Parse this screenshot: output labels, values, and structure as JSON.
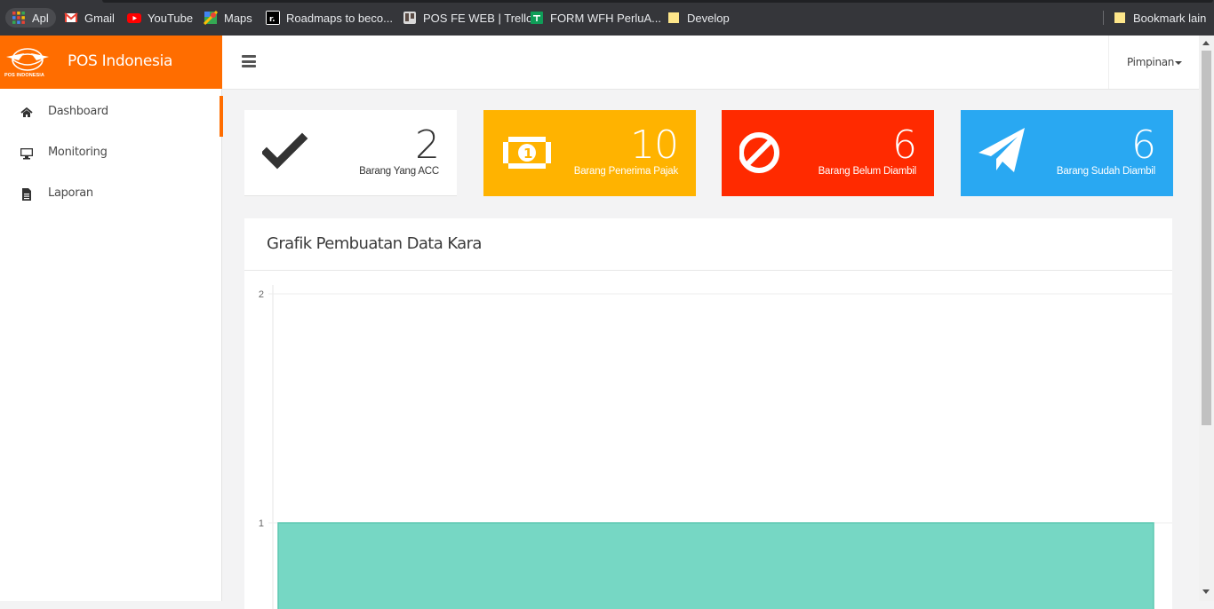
{
  "bookmarks": {
    "apps_label": "Apl",
    "items": [
      {
        "label": "Gmail",
        "icon": "gmail-icon"
      },
      {
        "label": "YouTube",
        "icon": "youtube-icon"
      },
      {
        "label": "Maps",
        "icon": "maps-icon"
      },
      {
        "label": "Roadmaps to beco...",
        "icon": "roadmap-icon"
      },
      {
        "label": "POS FE WEB | Trello",
        "icon": "trello-icon"
      },
      {
        "label": "FORM WFH PerluA...",
        "icon": "sheets-icon"
      },
      {
        "label": "Develop",
        "icon": "folder-icon"
      }
    ],
    "other_label": "Bookmark lain"
  },
  "brand": {
    "title": "POS Indonesia",
    "logo_text": "POS INDONESIA",
    "color": "#ff6d00"
  },
  "sidebar": {
    "items": [
      {
        "label": "Dashboard",
        "icon": "home-icon",
        "active": true
      },
      {
        "label": "Monitoring",
        "icon": "monitor-icon",
        "active": false
      },
      {
        "label": "Laporan",
        "icon": "document-icon",
        "active": false
      }
    ]
  },
  "topbar": {
    "user_label": "Pimpinan"
  },
  "cards": [
    {
      "value": "2",
      "label": "Barang Yang ACC",
      "icon": "check-icon",
      "color": "#ffffff"
    },
    {
      "value": "10",
      "label": "Barang Penerima Pajak",
      "icon": "money-icon",
      "color": "#ffb300"
    },
    {
      "value": "6",
      "label": "Barang Belum Diambil",
      "icon": "ban-icon",
      "color": "#ff2a00"
    },
    {
      "value": "6",
      "label": "Barang Sudah Diambil",
      "icon": "paper-plane-icon",
      "color": "#29a8f2"
    }
  ],
  "panel": {
    "title": "Grafik Pembuatan Data Kara"
  },
  "chart_data": {
    "type": "bar",
    "title": "",
    "categories": [
      ""
    ],
    "values": [
      1
    ],
    "ytick_labels": [
      "2",
      "1"
    ],
    "ylim": [
      0,
      2
    ],
    "bar_color": "#76d7c4",
    "grid": true
  }
}
